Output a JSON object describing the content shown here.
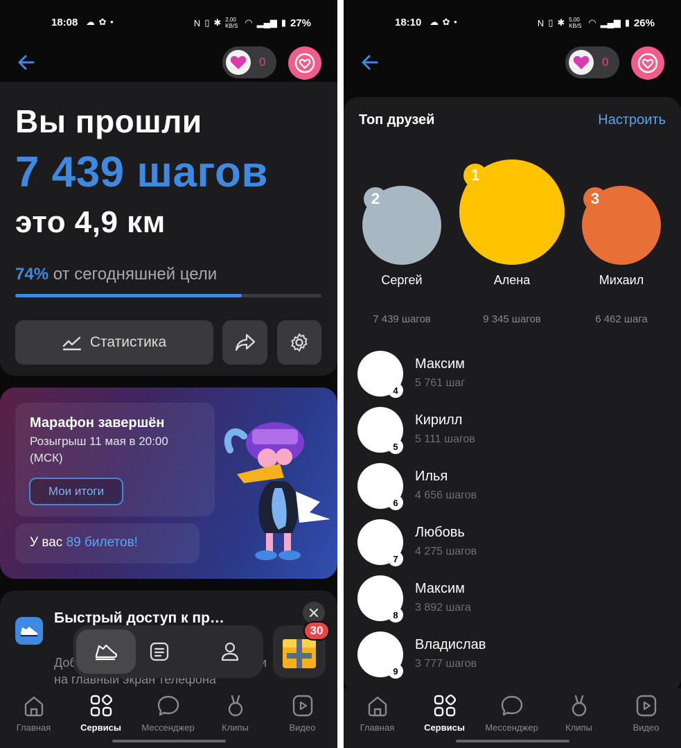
{
  "left": {
    "status": {
      "time": "18:08",
      "speed": "2,00 KB/S",
      "battery": "27%"
    },
    "likes_count": "0",
    "title_line1": "Вы прошли",
    "title_line2": "7 439 шагов",
    "title_line3": "это 4,9 км",
    "progress": {
      "percent_label": "74%",
      "text": "от сегодняшней цели",
      "fraction": 0.74
    },
    "stats_button": "Статистика",
    "banner": {
      "title": "Марафон завершён",
      "subtitle": "Розыгрыш 11 мая в 20:00 (МСК)",
      "button": "Мои итоги",
      "tickets_prefix": "У вас",
      "tickets_value": "89 билетов!"
    },
    "quick_access": {
      "title": "Быстрый доступ к пр…",
      "desc_start": "Доб",
      "desc_end": "и",
      "desc_line2": "на главный экран телефона"
    },
    "gift_badge": "30"
  },
  "right": {
    "status": {
      "time": "18:10",
      "speed": "5,00 KB/S",
      "battery": "26%"
    },
    "likes_count": "0",
    "section_title": "Топ друзей",
    "configure": "Настроить",
    "podium": [
      {
        "rank": "2",
        "name": "Сергей",
        "steps": "7 439 шагов",
        "color": "#a8b8c2"
      },
      {
        "rank": "1",
        "name": "Алена",
        "steps": "9 345 шагов",
        "color": "#ffc300"
      },
      {
        "rank": "3",
        "name": "Михаил",
        "steps": "6 462 шага",
        "color": "#e86f35"
      }
    ],
    "list": [
      {
        "rank": "4",
        "name": "Максим",
        "steps": "5 761 шаг"
      },
      {
        "rank": "5",
        "name": "Кирилл",
        "steps": "5 111 шагов"
      },
      {
        "rank": "6",
        "name": "Илья",
        "steps": "4 656 шагов"
      },
      {
        "rank": "7",
        "name": "Любовь",
        "steps": "4 275 шагов"
      },
      {
        "rank": "8",
        "name": "Максим",
        "steps": "3 892 шага"
      },
      {
        "rank": "9",
        "name": "Владислав",
        "steps": "3 777 шагов"
      }
    ]
  },
  "tabs": [
    "Главная",
    "Сервисы",
    "Мессенджер",
    "Клипы",
    "Видео"
  ],
  "colors": {
    "accent": "#3f8ae0",
    "pink": "#f25c8b",
    "bg": "#0a0a0a",
    "card": "#1c1c1e"
  }
}
